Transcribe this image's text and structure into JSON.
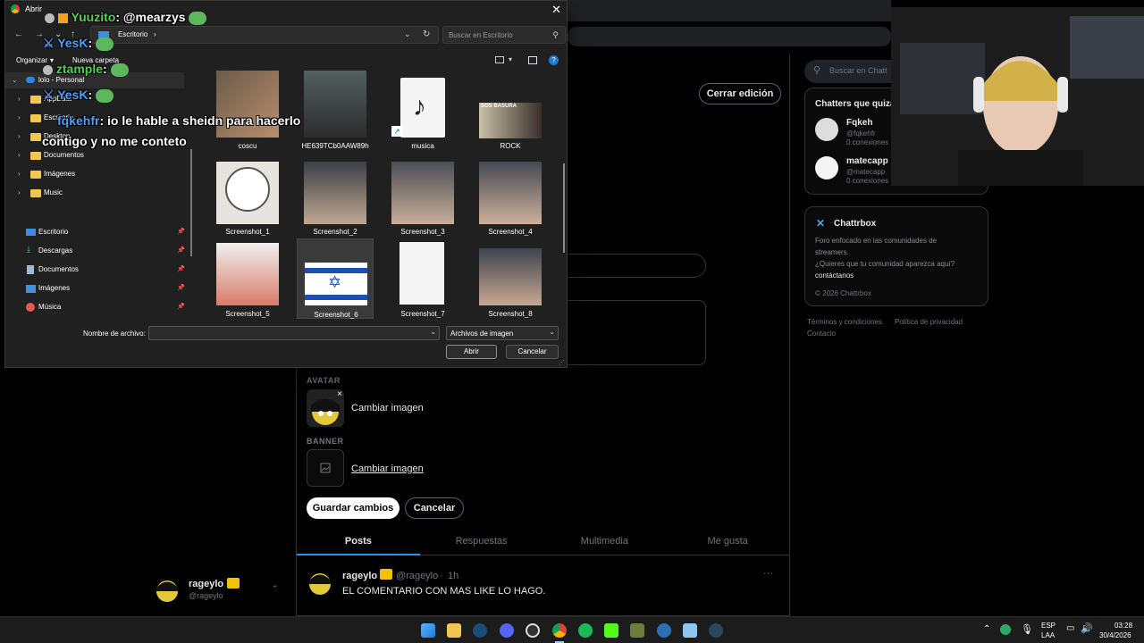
{
  "app": {
    "edit_button": "Cerrar edición",
    "avatar_label": "AVATAR",
    "banner_label": "BANNER",
    "change_image": "Cambiar imagen",
    "save_button": "Guardar cambios",
    "cancel_button": "Cancelar",
    "tabs": [
      "Posts",
      "Respuestas",
      "Multimedia",
      "Me gusta"
    ],
    "post": {
      "author": "rageylo",
      "handle": "@rageylo",
      "time": "1h",
      "text": "EL COMENTARIO CON MAS LIKE LO HAGO."
    },
    "sidebar_user": {
      "name": "rageylo",
      "handle": "@rageylo"
    },
    "search_placeholder": "Buscar en Chatt",
    "chatters_title": "Chatters que quizá",
    "chatters": [
      {
        "name": "Fqkeh",
        "handle": "@fqkehfr",
        "meta": "0 conexiones"
      },
      {
        "name": "matecapp",
        "handle": "@matecapp",
        "meta": "0 conexiones"
      }
    ],
    "brand": "Chattrbox",
    "brand_desc_1": "Foro enfocado en las comunidades de",
    "brand_desc_2": "streamers.",
    "brand_q": "¿Quieres que tu comunidad aparezca aquí?",
    "brand_link": "contáctanos",
    "copyright": "© 2026 Chattrbox",
    "footer": [
      "Términos y condiciones",
      "Política de privacidad",
      "Contacto"
    ]
  },
  "dialog": {
    "title": "Abrir",
    "path": "Escritorio",
    "search_placeholder": "Buscar en Escritorio",
    "organize": "Organizar",
    "new_folder": "Nueva carpeta",
    "tree": [
      {
        "label": "lolo - Personal"
      },
      {
        "label": "AppData"
      },
      {
        "label": "Escritorio"
      },
      {
        "label": "Desktop"
      },
      {
        "label": "Documentos"
      },
      {
        "label": "Imágenes"
      },
      {
        "label": "Music"
      }
    ],
    "quick": [
      {
        "label": "Escritorio"
      },
      {
        "label": "Descargas"
      },
      {
        "label": "Documentos"
      },
      {
        "label": "Imágenes"
      },
      {
        "label": "Música"
      }
    ],
    "files": [
      {
        "name": "coscu"
      },
      {
        "name": "HE639TCb0AAW89h"
      },
      {
        "name": "musica"
      },
      {
        "name": "ROCK"
      },
      {
        "name": "Screenshot_1"
      },
      {
        "name": "Screenshot_2"
      },
      {
        "name": "Screenshot_3"
      },
      {
        "name": "Screenshot_4"
      },
      {
        "name": "Screenshot_5"
      },
      {
        "name": "Screenshot_6"
      },
      {
        "name": "Screenshot_7"
      },
      {
        "name": "Screenshot_8"
      }
    ],
    "filename_label": "Nombre de archivo:",
    "filetype": "Archivos de imagen",
    "open_button": "Abrir",
    "cancel_button": "Cancelar",
    "rock_thumb_text": "SOS BASURA"
  },
  "chat_overlay": [
    {
      "name": "Yuuzito",
      "text": ": @mearzys"
    },
    {
      "name": "YesK",
      "text": ":"
    },
    {
      "name": "ztample",
      "text": ":"
    },
    {
      "name": "YesK",
      "text": ":"
    },
    {
      "name": "fqkehfr",
      "text": ": io le hable a sheidn para hacerlo"
    },
    {
      "name": "",
      "text": "contigo y no me conteto"
    }
  ],
  "taskbar": {
    "lang_1": "ESP",
    "lang_2": "LAA",
    "time": "03:28",
    "date": "30/4/2026"
  }
}
